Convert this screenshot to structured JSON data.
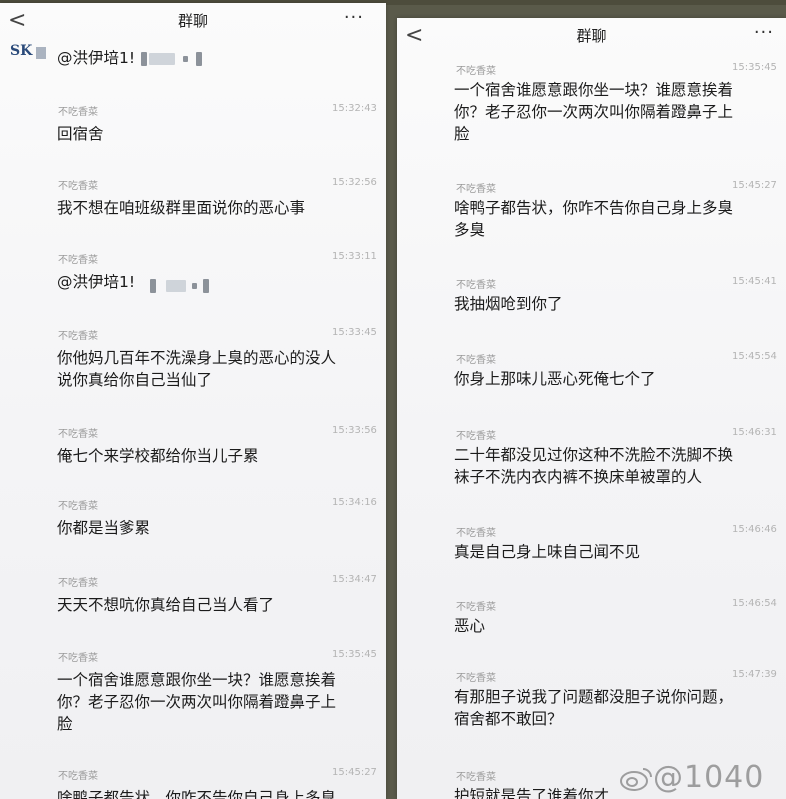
{
  "left": {
    "header": {
      "back": "<",
      "title": "群聊",
      "more": "···"
    },
    "avatar_text": "SK",
    "first_mention": "@洪伊培1!",
    "messages": [
      {
        "sender": "不吃香菜",
        "time": "15:32:43",
        "text": "回宿舍"
      },
      {
        "sender": "不吃香菜",
        "time": "15:32:56",
        "text": "我不想在咱班级群里面说你的恶心事"
      },
      {
        "sender": "不吃香菜",
        "time": "15:33:11",
        "text": "@洪伊培1!"
      },
      {
        "sender": "不吃香菜",
        "time": "15:33:45",
        "text": "你他妈几百年不洗澡身上臭的恶心的没人\n说你真给你自己当仙了"
      },
      {
        "sender": "不吃香菜",
        "time": "15:33:56",
        "text": "俺七个来学校都给你当儿子累"
      },
      {
        "sender": "不吃香菜",
        "time": "15:34:16",
        "text": "你都是当爹累"
      },
      {
        "sender": "不吃香菜",
        "time": "15:34:47",
        "text": "天天不想吭你真给自己当人看了"
      },
      {
        "sender": "不吃香菜",
        "time": "15:35:45",
        "text": "一个宿舍谁愿意跟你坐一块？谁愿意挨着\n你？老子忍你一次两次叫你隔着蹬鼻子上\n脸"
      },
      {
        "sender": "不吃香菜",
        "time": "15:45:27",
        "text": "啥鸭子都告状，你咋不告你自己身上多臭"
      }
    ]
  },
  "right": {
    "header": {
      "back": "<",
      "title": "群聊",
      "more": "···"
    },
    "messages": [
      {
        "sender": "不吃香菜",
        "time": "15:35:45",
        "text": "一个宿舍谁愿意跟你坐一块？谁愿意挨着\n你？老子忍你一次两次叫你隔着蹬鼻子上\n脸"
      },
      {
        "sender": "不吃香菜",
        "time": "15:45:27",
        "text": "啥鸭子都告状，你咋不告你自己身上多臭\n多臭"
      },
      {
        "sender": "不吃香菜",
        "time": "15:45:41",
        "text": "我抽烟呛到你了"
      },
      {
        "sender": "不吃香菜",
        "time": "15:45:54",
        "text": "你身上那味儿恶心死俺七个了"
      },
      {
        "sender": "不吃香菜",
        "time": "15:46:31",
        "text": "二十年都没见过你这种不洗脸不洗脚不换\n袜子不洗内衣内裤不换床单被罩的人"
      },
      {
        "sender": "不吃香菜",
        "time": "15:46:46",
        "text": "真是自己身上味自己闻不见"
      },
      {
        "sender": "不吃香菜",
        "time": "15:46:54",
        "text": "恶心"
      },
      {
        "sender": "不吃香菜",
        "time": "15:47:39",
        "text": "有那胆子说我了问题都没胆子说你问题，\n宿舍都不敢回？"
      },
      {
        "sender": "不吃香菜",
        "time": "",
        "text": "护短就是告了谁着你才..."
      }
    ],
    "watermark": "@1040"
  },
  "colors": {
    "background": "#5a5a4a",
    "panel": "#f7f7f8",
    "text": "#1b1b1b",
    "meta": "#9a9a9a"
  },
  "icons": [
    "back-arrow-icon",
    "more-icon",
    "weibo-logo-icon"
  ]
}
